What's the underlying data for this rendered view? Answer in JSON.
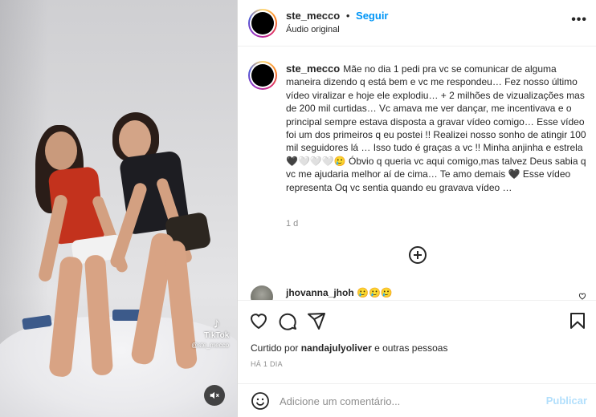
{
  "post": {
    "username": "ste_mecco",
    "follow_label": "Seguir",
    "dot": "•",
    "audio_label": "Áudio original",
    "more_label": "•••"
  },
  "caption": {
    "username": "ste_mecco",
    "text": "Mãe no dia 1 pedi pra vc se comunicar de alguma maneira dizendo q está bem e vc me respondeu… Fez nosso último vídeo viralizar e hoje ele explodiu… + 2 milhões de vizualizações mas de 200 mil curtidas… Vc amava me ver dançar, me incentivava e o principal sempre estava disposta a gravar vídeo comigo… Esse vídeo foi um dos primeiros q eu postei !! Realizei nosso sonho de atingir 100 mil seguidores lá … Isso tudo é graças a vc !! Minha anjinha e estrela 🖤🤍🤍🤍🥲 Óbvio q queria vc aqui comigo,mas talvez Deus sabia q vc me ajudaria melhor aí de cima… Te amo demais 🖤 Esse vídeo representa Oq vc sentia quando eu gravava vídeo …",
    "time": "1 d"
  },
  "comment": {
    "username": "jhovanna_jhoh",
    "text": "🥲🥲🥲"
  },
  "media": {
    "watermark_brand": "TikTok",
    "watermark_user": "@ste_mecco",
    "mute_icon": "speaker-muted-icon"
  },
  "engagement": {
    "liked_by_prefix": "Curtido por",
    "liked_by_user": "nandajulyoliver",
    "liked_by_suffix": "e outras pessoas",
    "posted_ago": "HÁ 1 DIA"
  },
  "composer": {
    "placeholder": "Adicione um comentário...",
    "publish_label": "Publicar"
  },
  "colors": {
    "accent": "#0095f6",
    "publish_disabled": "#b2dffc",
    "muted_text": "#8e8e8e"
  }
}
